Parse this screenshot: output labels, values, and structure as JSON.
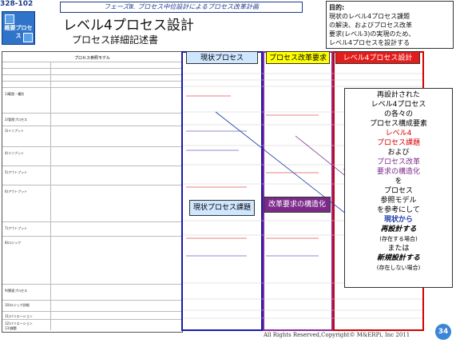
{
  "slide_id": "328-102",
  "logo": {
    "label": "概要プロセス"
  },
  "phase_banner": "フェーズⅢ. プロセス中位設計によるプロセス改革計画",
  "title": "レベル4プロセス設計",
  "subtitle": "プロセス詳細記述書",
  "purpose": {
    "heading": "目的:",
    "lines": [
      "現状のレベル4プロセス課題",
      "の解決、およびプロセス改革",
      "要求(レベル3)の実現のため、",
      "レベル4プロセスを設計する"
    ]
  },
  "doc": {
    "header": "プロセス参照モデル",
    "row_labels": [
      "1)範囲・種別",
      "2)管理プロセス",
      "3)インプット",
      "4)インプット",
      "5)アウトプット",
      "6)アウトプット",
      "7)アウトプット",
      "8)ロジック",
      "9)関連プロセス",
      "10)ロジック詳細",
      "11)バリエーション",
      "12)バリエーション",
      "13)課題"
    ]
  },
  "columns": {
    "current": "現状プロセス",
    "reform": "プロセス改革要求",
    "level4": "レベル4プロセス設計"
  },
  "labels": {
    "current_issue": "現状プロセス課題",
    "reform_structure": "改革要求の構造化"
  },
  "callout": {
    "l1": "再設計された",
    "l2": "レベル4プロセス",
    "l3": "の各々の",
    "l4": "プロセス構成要素",
    "l5": "レベル4",
    "l6": "プロセス課題",
    "l7": "および",
    "l8": "プロセス改革",
    "l9": "要求の構造化",
    "l10": "を",
    "l11": "プロセス",
    "l12": "参照モデル",
    "l13": "を参考にして",
    "l14": "現状から",
    "l15": "再設計する",
    "l16": "(存在する場合)",
    "l17": "または",
    "l18": "新規設計する",
    "l19": "(存在しない場合)"
  },
  "footer": "All Rights Reserved,Copyright© M&ERPi, Inc 2011",
  "page_number": "34",
  "colors": {
    "blue": "#1a1ab0",
    "purple": "#8a2a9a",
    "red": "#d40000",
    "current_bg": "#cfe6ff",
    "reform_bg": "#ffff00",
    "level4_bg": "#e31c1c"
  }
}
